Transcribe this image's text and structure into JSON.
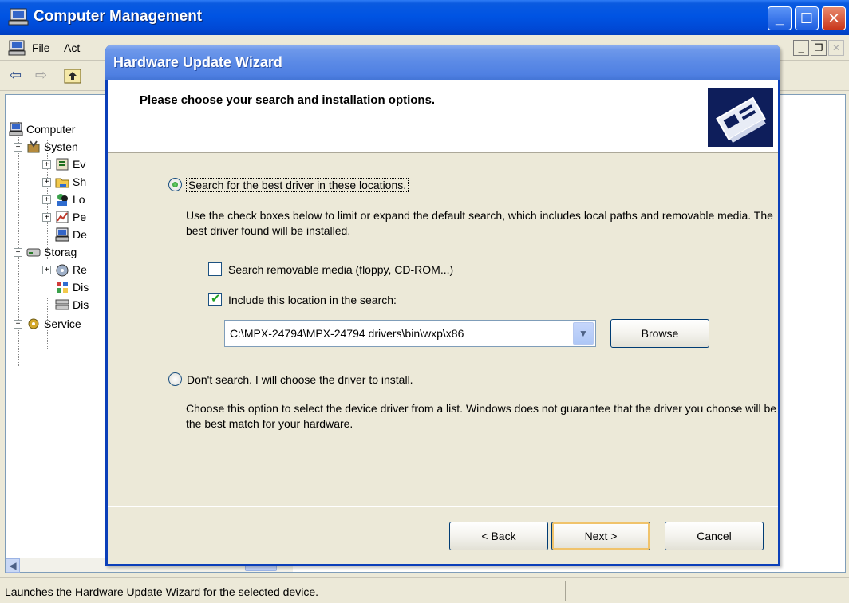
{
  "computer_management": {
    "title": "Computer Management",
    "menu": [
      {
        "label": "File"
      },
      {
        "label": "Act"
      }
    ],
    "tree": {
      "items": [
        {
          "label": "Computer",
          "level": 0,
          "icon": "computer-icon"
        },
        {
          "label": "Systen",
          "level": 1,
          "icon": "tools-icon",
          "expander": "−"
        },
        {
          "label": "Ev",
          "level": 2,
          "icon": "event-viewer-icon",
          "expander": "+"
        },
        {
          "label": "Sh",
          "level": 2,
          "icon": "shared-folder-icon",
          "expander": "+"
        },
        {
          "label": "Lo",
          "level": 2,
          "icon": "users-icon",
          "expander": "+"
        },
        {
          "label": "Pe",
          "level": 2,
          "icon": "performance-icon",
          "expander": "+"
        },
        {
          "label": "De",
          "level": 2,
          "icon": "device-manager-icon"
        },
        {
          "label": "Storag",
          "level": 1,
          "icon": "storage-icon",
          "expander": "−"
        },
        {
          "label": "Re",
          "level": 2,
          "icon": "removable-storage-icon",
          "expander": "+"
        },
        {
          "label": "Dis",
          "level": 2,
          "icon": "disk-defragmenter-icon"
        },
        {
          "label": "Dis",
          "level": 2,
          "icon": "disk-management-icon"
        },
        {
          "label": "Service",
          "level": 1,
          "icon": "services-icon",
          "expander": "+"
        }
      ]
    },
    "status_text": "Launches the Hardware Update Wizard for the selected device."
  },
  "wizard": {
    "title": "Hardware Update Wizard",
    "header_title": "Please choose your search and installation options.",
    "option_search": {
      "label": "Search for the best driver in these locations.",
      "selected": true,
      "description": "Use the check boxes below to limit or expand the default search, which includes local paths and removable media. The best driver found will be installed."
    },
    "check_removable": {
      "label": "Search removable media (floppy, CD-ROM...)",
      "checked": false
    },
    "check_location": {
      "label": "Include this location in the search:",
      "checked": true
    },
    "location_path": "C:\\MPX-24794\\MPX-24794 drivers\\bin\\wxp\\x86",
    "browse_label": "Browse",
    "option_manual": {
      "label": "Don't search. I will choose the driver to install.",
      "selected": false,
      "description": "Choose this option to select the device driver from a list.  Windows does not guarantee that the driver you choose will be the best match for your hardware."
    },
    "buttons": {
      "back": "< Back",
      "next": "Next >",
      "cancel": "Cancel"
    }
  },
  "colors": {
    "xp_title_blue": "#0054e3",
    "wizard_title_blue": "#5b8ae6",
    "dialog_face": "#ece9d8"
  }
}
